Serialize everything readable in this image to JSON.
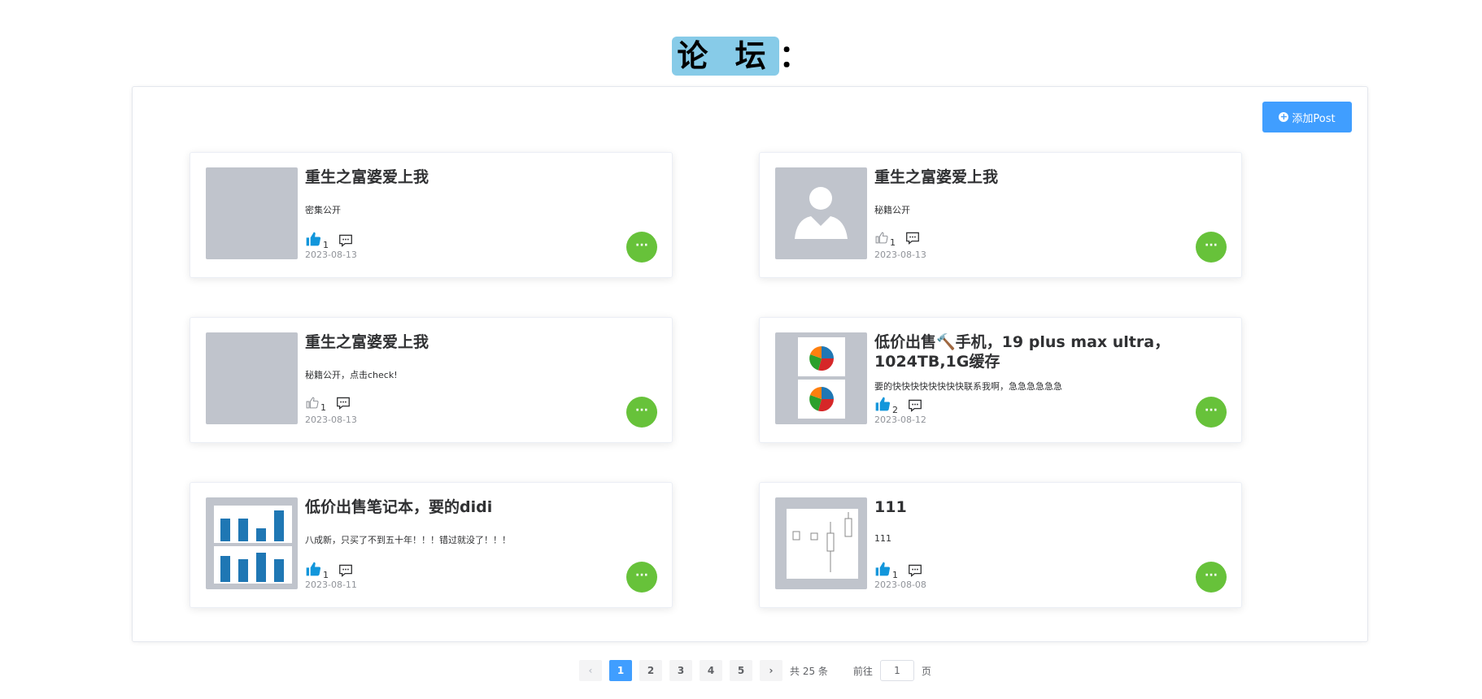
{
  "page": {
    "title_highlight": "论 坛",
    "title_suffix": "："
  },
  "toolbar": {
    "add_label": "添加Post"
  },
  "posts": [
    {
      "title": "重生之富婆爱上我",
      "desc": "密集公开",
      "likes": "1",
      "liked": true,
      "date": "2023-08-13",
      "thumb": "blank"
    },
    {
      "title": "重生之富婆爱上我",
      "desc": "秘籍公开",
      "likes": "1",
      "liked": false,
      "date": "2023-08-13",
      "thumb": "avatar"
    },
    {
      "title": "重生之富婆爱上我",
      "desc": "秘籍公开，点击check!",
      "likes": "1",
      "liked": false,
      "date": "2023-08-13",
      "thumb": "blank"
    },
    {
      "title": "低价出售🔨手机，19 plus max ultra，1024TB,1G缓存",
      "desc": "要的快快快快快快快快联系我啊，急急急急急急",
      "likes": "2",
      "liked": true,
      "date": "2023-08-12",
      "thumb": "pie"
    },
    {
      "title": "低价出售笔记本，要的didi",
      "desc": "八成新，只买了不到五十年！！！错过就没了！！！",
      "likes": "1",
      "liked": true,
      "date": "2023-08-11",
      "thumb": "bar"
    },
    {
      "title": "111",
      "desc": "111",
      "likes": "1",
      "liked": true,
      "date": "2023-08-08",
      "thumb": "box"
    }
  ],
  "more_label": "···",
  "pagination": {
    "prev": "‹",
    "next": "›",
    "pages": [
      "1",
      "2",
      "3",
      "4",
      "5"
    ],
    "active_page": "1",
    "total": "共 25 条",
    "goto_prefix": "前往",
    "goto_value": "1",
    "goto_suffix": "页"
  },
  "colors": {
    "accent": "#409eff",
    "success": "#67c23a",
    "title_highlight": "#87cbe8",
    "like_active": "#1296db"
  }
}
